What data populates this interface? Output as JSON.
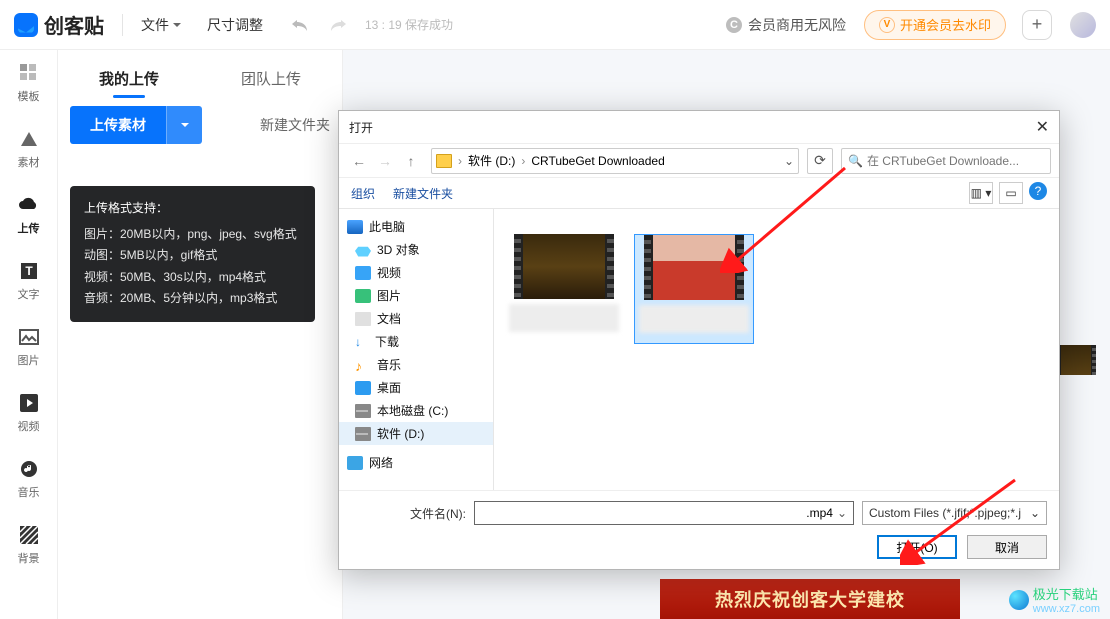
{
  "top": {
    "logo_text": "创客贴",
    "file_menu": "文件",
    "size_menu": "尺寸调整",
    "save_status": "13 : 19 保存成功",
    "notice_text": "会员商用无风险",
    "vip_label": "开通会员去水印",
    "vip_mark": "V"
  },
  "side": [
    "模板",
    "素材",
    "上传",
    "文字",
    "图片",
    "视频",
    "音乐",
    "背景"
  ],
  "panel": {
    "tab_my": "我的上传",
    "tab_team": "团队上传",
    "upload_label": "上传素材",
    "newfolder_label": "新建文件夹"
  },
  "tooltip": {
    "heading": "上传格式支持：",
    "l1": "图片：20MB以内，png、jpeg、svg格式",
    "l2": "动图：5MB以内，gif格式",
    "l3": "视频：50MB、30s以内，mp4格式",
    "l4": "音频：20MB、5分钟以内，mp3格式"
  },
  "dialog": {
    "title": "打开",
    "crumb1": "软件 (D:)",
    "crumb2": "CRTubeGet Downloaded",
    "search_placeholder": "在 CRTubeGet Downloade...",
    "organise": "组织",
    "newfolder": "新建文件夹",
    "tree": {
      "root": "此电脑",
      "n0": "3D 对象",
      "n1": "视频",
      "n2": "图片",
      "n3": "文档",
      "n4": "下载",
      "n5": "音乐",
      "n6": "桌面",
      "n7": "本地磁盘 (C:)",
      "n8": "软件 (D:)",
      "net": "网络"
    },
    "filename_label": "文件名(N):",
    "filename_value": ".mp4",
    "filter_label": "Custom Files (*.jfif;*.pjpeg;*.j",
    "open_btn": "打开(O)",
    "cancel_btn": "取消"
  },
  "banner_text": "热烈庆祝创客大学建校",
  "watermark": {
    "name": "极光下载站",
    "url": "www.xz7.com"
  }
}
